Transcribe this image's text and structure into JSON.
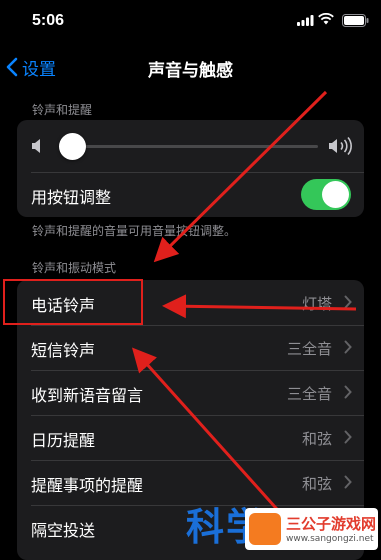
{
  "status_bar": {
    "time": "5:06"
  },
  "nav": {
    "back_label": "设置",
    "title": "声音与触感"
  },
  "ringer": {
    "header": "铃声和提醒",
    "volume_fraction": 0.0,
    "toggle_label": "用按钮调整",
    "toggle_on": true,
    "footer": "铃声和提醒的音量可用音量按钮调整。"
  },
  "patterns": {
    "header": "铃声和振动模式",
    "items": [
      {
        "label": "电话铃声",
        "value": "灯塔"
      },
      {
        "label": "短信铃声",
        "value": "三全音"
      },
      {
        "label": "收到新语音留言",
        "value": "三全音"
      },
      {
        "label": "日历提醒",
        "value": "和弦"
      },
      {
        "label": "提醒事项的提醒",
        "value": "和弦"
      },
      {
        "label": "隔空投送",
        "value": ""
      }
    ]
  },
  "watermark": {
    "text": "科学",
    "site_name": "三公子游戏网",
    "site_url": "www.sangongzi.net"
  },
  "colors": {
    "accent": "#0a84ff",
    "toggle_on": "#34c759",
    "annotation": "#e0201c",
    "cell_bg": "#1c1c1e"
  }
}
